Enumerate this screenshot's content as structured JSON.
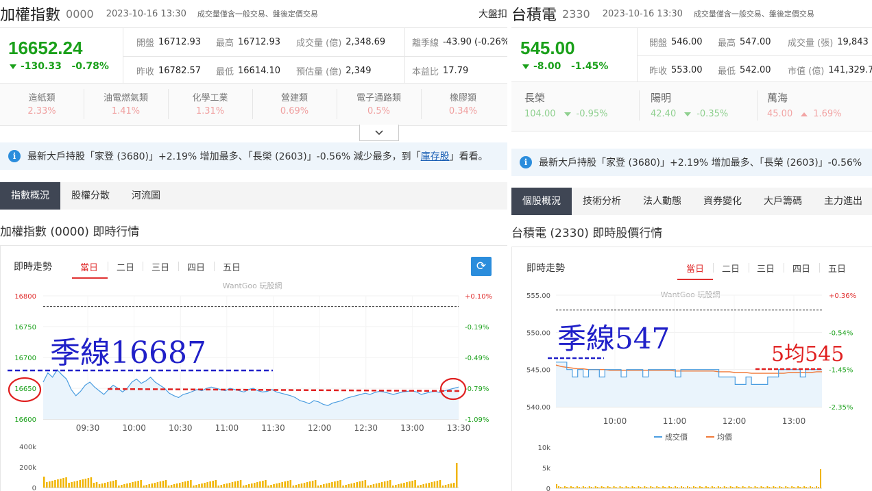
{
  "left": {
    "header": {
      "name": "加權指數",
      "code": "0000",
      "time": "2023-10-16 13:30",
      "note": "成交量僅含一般交易、盤後定價交易",
      "more": "大盤扣"
    },
    "quote": {
      "price": "16652.24",
      "change": "-130.33",
      "change_pct": "-0.78%",
      "row1": [
        {
          "label": "開盤",
          "value": "16712.93"
        },
        {
          "label": "最高",
          "value": "16712.93"
        },
        {
          "label": "成交量 (億)",
          "value": "2,348.69"
        },
        {
          "label": "離季線",
          "value": "-43.90 (-0.26%"
        }
      ],
      "row2": [
        {
          "label": "昨收",
          "value": "16782.57"
        },
        {
          "label": "最低",
          "value": "16614.10"
        },
        {
          "label": "預估量 (億)",
          "value": "2,349"
        },
        {
          "label": "本益比",
          "value": "17.79"
        }
      ]
    },
    "sectors": [
      {
        "name": "造紙類",
        "pct": "2.33%"
      },
      {
        "name": "油電燃氣類",
        "pct": "1.41%"
      },
      {
        "name": "化學工業",
        "pct": "1.31%"
      },
      {
        "name": "營建類",
        "pct": "0.69%"
      },
      {
        "name": "電子通路類",
        "pct": "0.5%"
      },
      {
        "name": "橡膠類",
        "pct": "0.34%"
      }
    ],
    "expand_icon": "chevron-down-icon",
    "info": {
      "text1": "最新大戶持股「家登 (3680)」+2.19% 增加最多、「長榮 (2603)」-0.56% 減少最多，到「",
      "link": "庫存股",
      "text2": "」看看。"
    },
    "tabs": [
      "指數概況",
      "股權分散",
      "河流圖"
    ],
    "section_title": "加權指數 (0000) 即時行情",
    "chart": {
      "title": "即時走勢",
      "day_tabs": [
        "當日",
        "二日",
        "三日",
        "四日",
        "五日"
      ],
      "watermark": "WantGoo 玩股網",
      "annotation": "季線16687",
      "refresh_icon": "refresh-icon",
      "vol_labels": [
        "400k",
        "200k",
        "0"
      ]
    },
    "chart_data": {
      "type": "line",
      "x_ticks": [
        "09:30",
        "10:00",
        "10:30",
        "11:00",
        "11:30",
        "12:00",
        "12:30",
        "13:00",
        "13:30"
      ],
      "y_ticks": [
        16800,
        16750,
        16700,
        16650,
        16600
      ],
      "y_right_ticks": [
        "+0.10%",
        "-0.19%",
        "-0.49%",
        "-0.79%",
        "-1.09%"
      ],
      "ylim": [
        16600,
        16800
      ],
      "reference_level": 16782.57,
      "quarter_line": 16687,
      "series": [
        {
          "values": [
            16660,
            16675,
            16668,
            16680,
            16672,
            16665,
            16648,
            16638,
            16645,
            16655,
            16660,
            16652,
            16646,
            16640,
            16648,
            16655,
            16650,
            16644,
            16650,
            16660,
            16665,
            16658,
            16662,
            16668,
            16660,
            16655,
            16650,
            16642,
            16638,
            16635,
            16640,
            16642,
            16645,
            16648,
            16646,
            16650,
            16652,
            16650,
            16648,
            16646,
            16650,
            16648,
            16646,
            16644,
            16648,
            16650,
            16646,
            16644,
            16645,
            16648,
            16644,
            16642,
            16640,
            16638,
            16635,
            16630,
            16628,
            16625,
            16630,
            16628,
            16624,
            16622,
            16626,
            16628,
            16630,
            16634,
            16636,
            16638,
            16640,
            16642,
            16640,
            16643,
            16645,
            16644,
            16642,
            16640,
            16642,
            16644,
            16645,
            16646,
            16644,
            16640,
            16642,
            16644,
            16645,
            16643,
            16646,
            16648,
            16650,
            16652
          ]
        }
      ]
    }
  },
  "right": {
    "header": {
      "name": "台積電",
      "code": "2330",
      "time": "2023-10-16 13:30",
      "note": "成交量僅含一般交易、盤後定價交易"
    },
    "quote": {
      "price": "545.00",
      "change": "-8.00",
      "change_pct": "-1.45%",
      "row1": [
        {
          "label": "開盤",
          "value": "546.00"
        },
        {
          "label": "最高",
          "value": "547.00"
        },
        {
          "label": "成交量 (張)",
          "value": "19,843"
        }
      ],
      "row2": [
        {
          "label": "昨收",
          "value": "553.00"
        },
        {
          "label": "最低",
          "value": "542.00"
        },
        {
          "label": "市值 (億)",
          "value": "141,329.7"
        }
      ]
    },
    "related": [
      {
        "name": "長榮",
        "price": "104.00",
        "pct": "-0.95%",
        "dir": "down"
      },
      {
        "name": "陽明",
        "price": "42.40",
        "pct": "-0.35%",
        "dir": "down"
      },
      {
        "name": "萬海",
        "price": "45.00",
        "pct": "1.69%",
        "dir": "up"
      }
    ],
    "info": {
      "text1": "最新大戶持股「家登 (3680)」+2.19% 增加最多、「長榮 (2603)」-0.56%"
    },
    "tabs": [
      "個股概況",
      "技術分析",
      "法人動態",
      "資券變化",
      "大戶籌碼",
      "主力進出"
    ],
    "section_title": "台積電 (2330) 即時股價行情",
    "chart": {
      "title": "即時走勢",
      "day_tabs": [
        "當日",
        "二日",
        "三日",
        "四日",
        "五日"
      ],
      "watermark": "WantGoo 玩股網",
      "annotation": "季線547",
      "annotation2": "5均545",
      "legend": [
        "成交價",
        "均價"
      ],
      "vol_labels": [
        "10k",
        "5k",
        "0"
      ]
    },
    "chart_data": {
      "type": "line",
      "x_ticks": [
        "10:00",
        "11:00",
        "12:00",
        "13:00"
      ],
      "y_ticks": [
        "555.00",
        "550.00",
        "545.00",
        "540.00"
      ],
      "y_right_ticks": [
        "+0.36%",
        "-0.54%",
        "-1.45%",
        "-2.35%"
      ],
      "ylim": [
        540,
        555
      ],
      "reference_level": 553,
      "quarter_line": 547,
      "ma5": 545,
      "series": [
        {
          "name": "成交價",
          "values": [
            546,
            546,
            545,
            544,
            545,
            544,
            545,
            545,
            544,
            545,
            545,
            545,
            544,
            545,
            545,
            545,
            544,
            545,
            545,
            545,
            545,
            545,
            544,
            545,
            545,
            545,
            545,
            545,
            545,
            545,
            544,
            544,
            544,
            543,
            543,
            544,
            543,
            543,
            543,
            544,
            544,
            545,
            545,
            545,
            545,
            544,
            545,
            545,
            545,
            545
          ]
        },
        {
          "name": "均價",
          "values": [
            545.6,
            545.4,
            545.3,
            545.2,
            545.1,
            545.1,
            545.0,
            545.0,
            545.0,
            545.0,
            544.9,
            544.9,
            544.9,
            544.9,
            544.9,
            544.9,
            544.9,
            544.9,
            544.9,
            544.9,
            544.9,
            544.9,
            544.8,
            544.8,
            544.8,
            544.8,
            544.8,
            544.8,
            544.8,
            544.8,
            544.7,
            544.7,
            544.7,
            544.6,
            544.6,
            544.6,
            544.5,
            544.5,
            544.5,
            544.5,
            544.5,
            544.5,
            544.5,
            544.6,
            544.6,
            544.6,
            544.6,
            544.6,
            544.7,
            544.7
          ]
        }
      ]
    }
  },
  "colors": {
    "down": "#1aa01a",
    "up": "#e03030",
    "line": "#4a9de0",
    "avg": "#f07a3a",
    "volume": "#f0b400",
    "annotation_blue": "#2020c8",
    "annotation_red": "#e02020"
  }
}
